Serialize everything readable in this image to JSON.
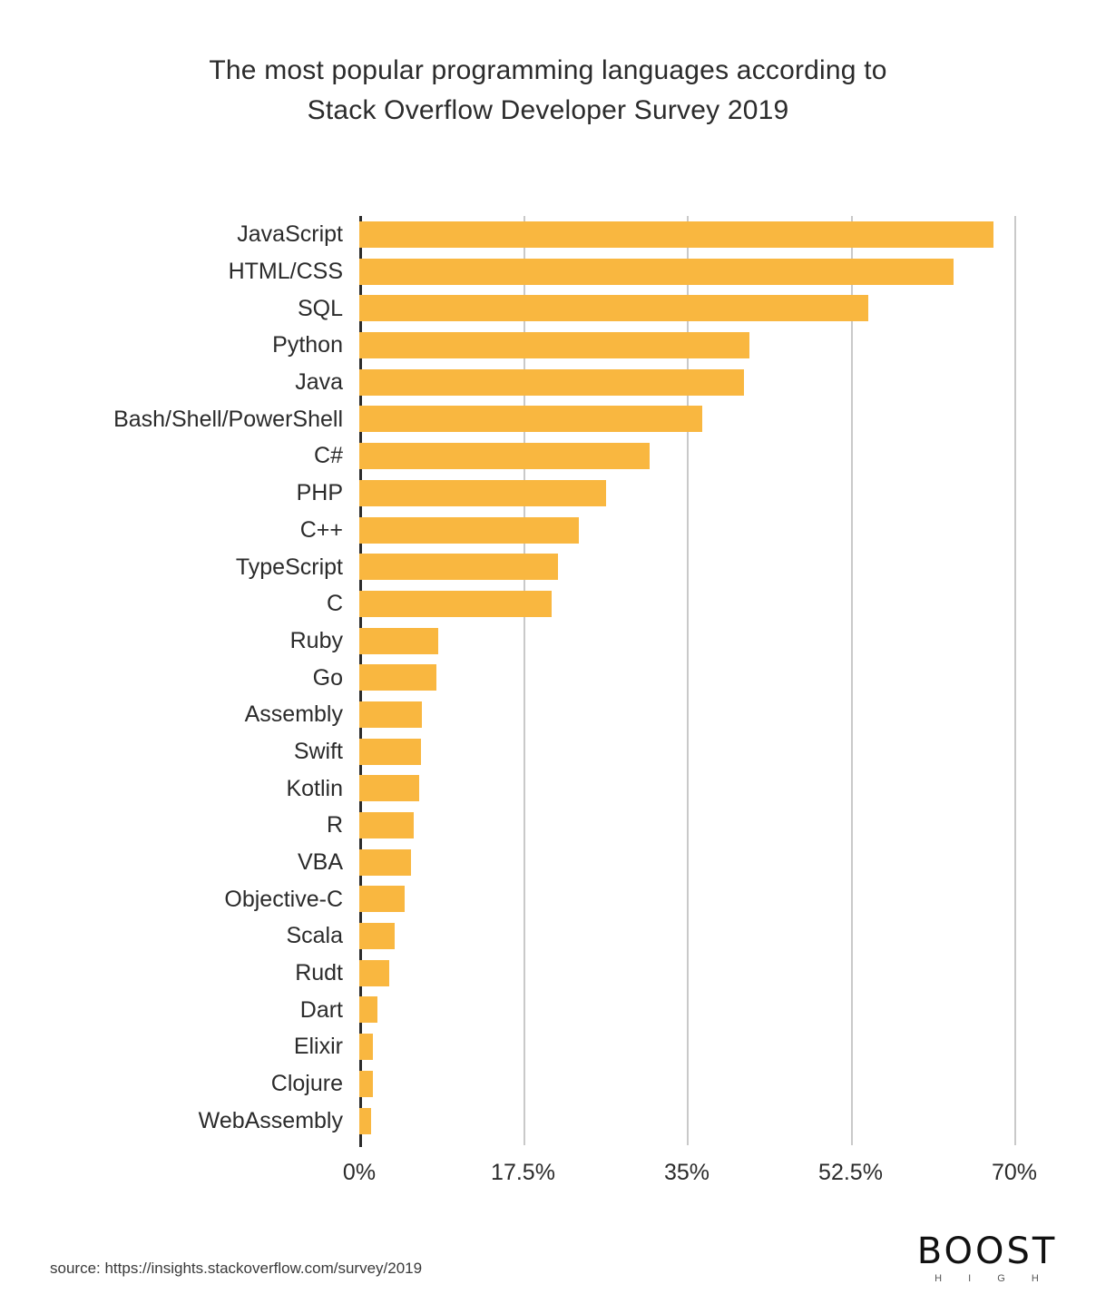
{
  "title": {
    "line1": "The most popular programming languages according to",
    "line2": "Stack Overflow Developer Survey 2019"
  },
  "footer": {
    "source": "source: https://insights.stackoverflow.com/survey/2019",
    "logo_word": "BOOST",
    "logo_sub": "H I G H"
  },
  "colors": {
    "bar": "#f9b740",
    "gridline": "#c9c9c9",
    "axis": "#2b2b2b",
    "text": "#2b2b2b",
    "background": "#ffffff"
  },
  "chart_data": {
    "type": "bar",
    "orientation": "horizontal",
    "title": "The most popular programming languages according to Stack Overflow Developer Survey 2019",
    "xlabel": "",
    "ylabel": "",
    "xlim": [
      0,
      70
    ],
    "grid": true,
    "legend": false,
    "xticks": [
      0,
      17.5,
      35,
      52.5,
      70
    ],
    "xticklabels": [
      "0%",
      "17.5%",
      "35%",
      "52.5%",
      "70%"
    ],
    "categories": [
      "JavaScript",
      "HTML/CSS",
      "SQL",
      "Python",
      "Java",
      "Bash/Shell/PowerShell",
      "C#",
      "PHP",
      "C++",
      "TypeScript",
      "C",
      "Ruby",
      "Go",
      "Assembly",
      "Swift",
      "Kotlin",
      "R",
      "VBA",
      "Objective-C",
      "Scala",
      "Rudt",
      "Dart",
      "Elixir",
      "Clojure",
      "WebAssembly"
    ],
    "values": [
      67.8,
      63.5,
      54.4,
      41.7,
      41.1,
      36.6,
      31.0,
      26.4,
      23.5,
      21.2,
      20.6,
      8.4,
      8.2,
      6.7,
      6.6,
      6.4,
      5.8,
      5.5,
      4.8,
      3.8,
      3.2,
      1.9,
      1.5,
      1.5,
      1.3
    ]
  }
}
